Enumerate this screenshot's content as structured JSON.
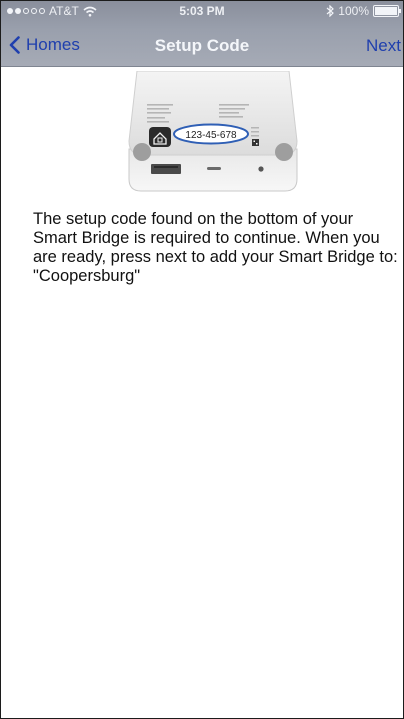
{
  "status_bar": {
    "carrier": "AT&T",
    "time": "5:03 PM",
    "battery": "100%"
  },
  "nav": {
    "back_label": "Homes",
    "title": "Setup Code",
    "next_label": "Next"
  },
  "device": {
    "setup_code": "123-45-678"
  },
  "message": {
    "body": "The setup code found on the bottom of your Smart Bridge is required to continue. When you are ready, press next to add your Smart Bridge to:",
    "home_name": "\"Coopersburg\""
  },
  "colors": {
    "nav_background": "#9aa0ad",
    "link_blue": "#1f3fae",
    "code_ring": "#2f5fb5"
  },
  "icons": [
    "signal-dots-icon",
    "wifi-icon",
    "bluetooth-icon",
    "battery-icon",
    "chevron-left-icon",
    "homekit-icon",
    "qr-code-icon"
  ]
}
